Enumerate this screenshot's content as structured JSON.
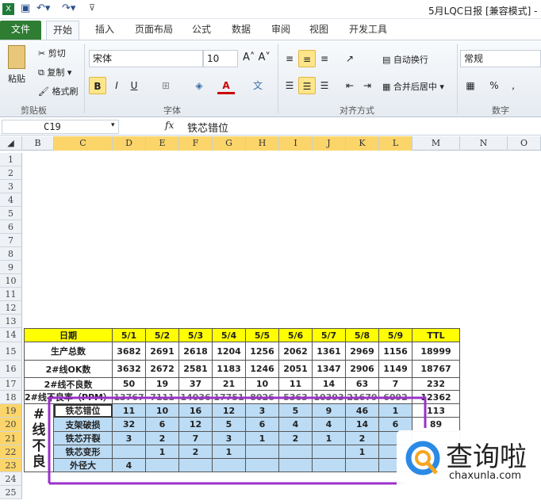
{
  "window": {
    "title": "5月LQC日报  [兼容模式] -"
  },
  "tabs": [
    "文件",
    "开始",
    "插入",
    "页面布局",
    "公式",
    "数据",
    "审阅",
    "视图",
    "开发工具"
  ],
  "ribbon": {
    "clipboard": {
      "paste": "粘贴",
      "cut": "剪切",
      "copy": "复制",
      "format_painter": "格式刷",
      "label": "剪贴板"
    },
    "font": {
      "name": "宋体",
      "size": "10",
      "bold": "B",
      "italic": "I",
      "underline": "U",
      "label": "字体"
    },
    "alignment": {
      "wrap": "自动换行",
      "merge": "合并后居中",
      "label": "对齐方式"
    },
    "number": {
      "format": "常规",
      "percent": "%",
      "comma": ",",
      "label": "数字"
    }
  },
  "formula_bar": {
    "name_box": "C19",
    "fx": "fx",
    "value": "铁芯错位"
  },
  "columns": [
    "B",
    "C",
    "D",
    "E",
    "F",
    "G",
    "H",
    "I",
    "J",
    "K",
    "L",
    "M",
    "N",
    "O"
  ],
  "rows": [
    "1",
    "2",
    "3",
    "4",
    "5",
    "6",
    "7",
    "8",
    "9",
    "10",
    "11",
    "12",
    "13",
    "14",
    "15",
    "16",
    "17",
    "18",
    "19",
    "20",
    "21",
    "22",
    "23",
    "24",
    "25"
  ],
  "table": {
    "header": [
      "日期",
      "5/1",
      "5/2",
      "5/3",
      "5/4",
      "5/5",
      "5/6",
      "5/7",
      "5/8",
      "5/9",
      "TTL"
    ],
    "summary": [
      [
        "生产总数",
        "3682",
        "2691",
        "2618",
        "1204",
        "1256",
        "2062",
        "1361",
        "2969",
        "1156",
        "18999"
      ],
      [
        "2#线OK数",
        "3632",
        "2672",
        "2581",
        "1183",
        "1246",
        "2051",
        "1347",
        "2906",
        "1149",
        "18767"
      ],
      [
        "2#线不良数",
        "50",
        "19",
        "37",
        "21",
        "10",
        "11",
        "14",
        "63",
        "7",
        "232"
      ],
      [
        "2#线不良率（PPM）",
        "13767",
        "7111",
        "14036",
        "17751",
        "8026",
        "5363",
        "10393",
        "21679",
        "6092",
        "12362"
      ]
    ],
    "side_label": [
      "#",
      "线",
      "不",
      "良"
    ],
    "defects": [
      [
        "铁芯错位",
        "11",
        "10",
        "16",
        "12",
        "3",
        "5",
        "9",
        "46",
        "1",
        "113"
      ],
      [
        "支架破损",
        "32",
        "6",
        "12",
        "5",
        "6",
        "4",
        "4",
        "14",
        "6",
        "89"
      ],
      [
        "铁芯开裂",
        "3",
        "2",
        "7",
        "3",
        "1",
        "2",
        "1",
        "2",
        "",
        ""
      ],
      [
        "铁芯变形",
        "",
        "1",
        "2",
        "1",
        "",
        "",
        "",
        "1",
        "",
        ""
      ],
      [
        "外径大",
        "4",
        "",
        "",
        "",
        "",
        "",
        "",
        "",
        "",
        ""
      ]
    ]
  },
  "watermark": {
    "brand": "查询啦",
    "url": "chaxunla.com"
  },
  "colors": {
    "header_yellow": "#ffff00",
    "selection_blue": "#bcdcf5",
    "highlight_purple": "#9b30c8",
    "file_tab": "#2e7d32"
  }
}
